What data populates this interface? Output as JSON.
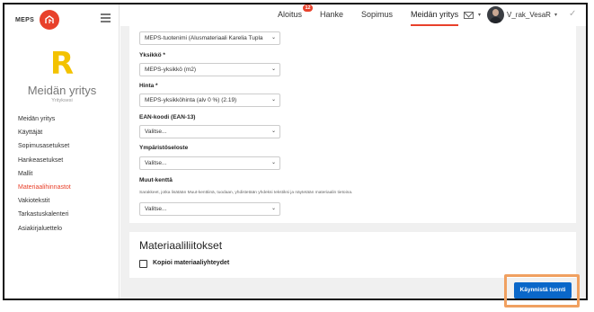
{
  "app": {
    "logo_text": "MEPS",
    "company_initial": "R",
    "company_name": "Meidän yritys",
    "company_sub": "Yrityksesi"
  },
  "sidebar": {
    "items": [
      {
        "label": "Meidän yritys"
      },
      {
        "label": "Käyttäjät"
      },
      {
        "label": "Sopimusasetukset"
      },
      {
        "label": "Hankeasetukset"
      },
      {
        "label": "Mallit"
      },
      {
        "label": "Materiaalihinnastot",
        "active": true
      },
      {
        "label": "Vakiotekstit"
      },
      {
        "label": "Tarkastuskalenteri"
      },
      {
        "label": "Asiakirjaluettelo"
      }
    ]
  },
  "topbar": {
    "nav": [
      {
        "label": "Aloitus",
        "badge": "12"
      },
      {
        "label": "Hanke"
      },
      {
        "label": "Sopimus"
      },
      {
        "label": "Meidän yritys",
        "active": true
      }
    ],
    "username": "V_rak_VesaR"
  },
  "form": {
    "product_name": "MEPS-tuotenimi   (Alusmateriaali Karelia Tupla",
    "unit_label": "Yksikkö *",
    "unit_value": "MEPS-yksikkö    (m2)",
    "price_label": "Hinta *",
    "price_value": "MEPS-yksikköhinta (alv 0 %)    (2.19)",
    "ean_label": "EAN-koodi (EAN-13)",
    "ean_value": "Valitse...",
    "env_label": "Ympäristöseloste",
    "env_value": "Valitse...",
    "custom_label": "Muut-kenttä",
    "custom_hint": "Sarakkeet, jotka lisätään Muut-kenttiinä, tuodaan, yhdistetään yhdeksi tekstiksi ja näytetään materiaalin tietoina.",
    "custom_value": "Valitse..."
  },
  "attachments": {
    "title": "Materiaaliliitokset",
    "copy_label": "Kopioi materiaaliyhteydet"
  },
  "actions": {
    "start_label": "Käynnistä tuonti"
  },
  "colors": {
    "accent": "#e8412b",
    "logo_letter": "#f3c200",
    "primary_button": "#0a67c9",
    "highlight": "#f0a060"
  }
}
